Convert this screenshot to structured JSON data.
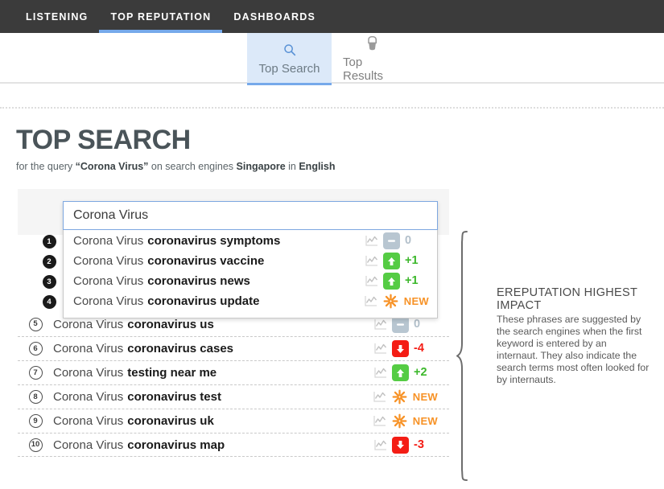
{
  "topnav": {
    "items": [
      {
        "label": "LISTENING",
        "active": false
      },
      {
        "label": "TOP REPUTATION",
        "active": true
      },
      {
        "label": "DASHBOARDS",
        "active": false
      }
    ]
  },
  "subtabs": [
    {
      "label": "Top Search",
      "icon": "search-icon",
      "active": true
    },
    {
      "label": "Top Results",
      "icon": "paint-bucket-icon",
      "active": false
    }
  ],
  "header": {
    "title": "TOP SEARCH",
    "subtitle_prefix": "for the query ",
    "query": "“Corona Virus”",
    "subtitle_mid": " on search engines ",
    "engine": "Singapore",
    "subtitle_in": " in ",
    "language": "English"
  },
  "search": {
    "value": "Corona Virus",
    "placeholder": "Corona Virus"
  },
  "results": [
    {
      "rank": "1",
      "base": "Corona Virus",
      "suggestion": "coronavirus symptoms",
      "trend": "flat",
      "delta": "0",
      "highlighted": true
    },
    {
      "rank": "2",
      "base": "Corona Virus",
      "suggestion": "coronavirus vaccine",
      "trend": "up",
      "delta": "+1",
      "highlighted": true
    },
    {
      "rank": "3",
      "base": "Corona Virus",
      "suggestion": "coronavirus news",
      "trend": "up",
      "delta": "+1",
      "highlighted": true
    },
    {
      "rank": "4",
      "base": "Corona Virus",
      "suggestion": "coronavirus update",
      "trend": "new",
      "delta": "NEW",
      "highlighted": true
    },
    {
      "rank": "5",
      "base": "Corona Virus",
      "suggestion": "coronavirus us",
      "trend": "flat",
      "delta": "0",
      "highlighted": false
    },
    {
      "rank": "6",
      "base": "Corona Virus",
      "suggestion": "coronavirus cases",
      "trend": "down",
      "delta": "-4",
      "highlighted": false
    },
    {
      "rank": "7",
      "base": "Corona Virus",
      "suggestion": "testing near me",
      "trend": "up",
      "delta": "+2",
      "highlighted": false
    },
    {
      "rank": "8",
      "base": "Corona Virus",
      "suggestion": "coronavirus test",
      "trend": "new",
      "delta": "NEW",
      "highlighted": false
    },
    {
      "rank": "9",
      "base": "Corona Virus",
      "suggestion": "coronavirus uk",
      "trend": "new",
      "delta": "NEW",
      "highlighted": false
    },
    {
      "rank": "10",
      "base": "Corona Virus",
      "suggestion": "coronavirus map",
      "trend": "down",
      "delta": "-3",
      "highlighted": false
    }
  ],
  "note": {
    "title": "EREPUTATION HIGHEST IMPACT",
    "body": "These phrases are suggested by the search engines when the first keyword is entered by an internaut. They also indicate the search terms most often looked for by internauts."
  },
  "colors": {
    "nav_bg": "#3b3b3b",
    "accent_blue": "#76a9ea",
    "tab_active_bg": "#dce9f9",
    "up_green": "#55cc44",
    "up_text_green": "#3cb82b",
    "down_red": "#f41d15",
    "flat_gray": "#b8c6d1",
    "new_orange": "#f79226",
    "title_gray": "#4a5459"
  }
}
